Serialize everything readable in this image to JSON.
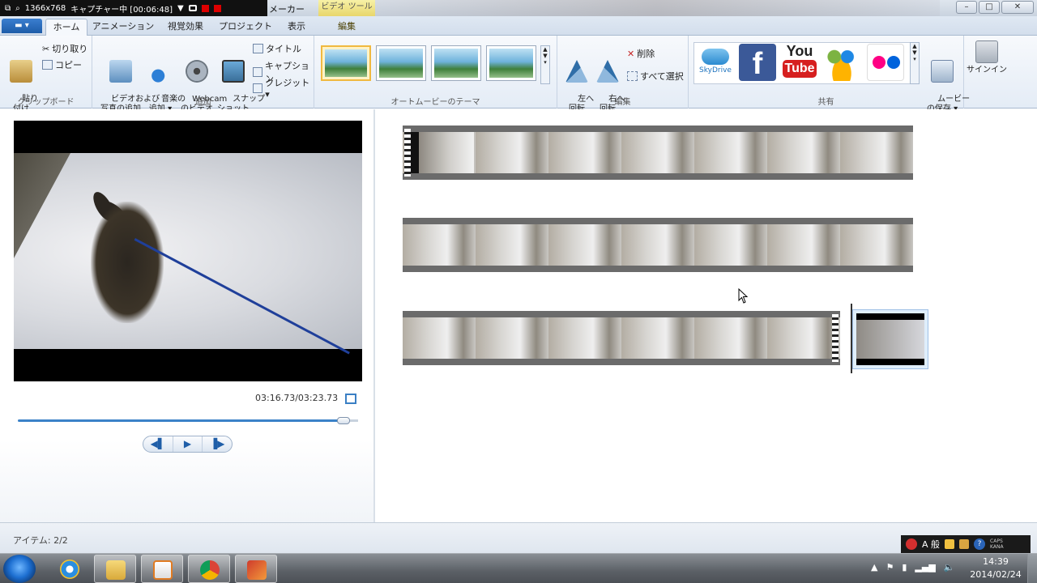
{
  "capture_toolbar": {
    "resolution": "1366x768",
    "status": "キャプチャー中 [00:06:48]"
  },
  "app": {
    "title_fragment": "メーカー",
    "context_tab_label": "ビデオ ツール"
  },
  "window_controls": {
    "minimize": "–",
    "maximize": "□",
    "close": "✕"
  },
  "tabs": [
    {
      "label": "ホーム",
      "active": true
    },
    {
      "label": "アニメーション"
    },
    {
      "label": "視覚効果"
    },
    {
      "label": "プロジェクト"
    },
    {
      "label": "表示"
    },
    {
      "label": "編集",
      "context": true
    }
  ],
  "ribbon": {
    "clipboard": {
      "paste": "貼り\n付け",
      "cut": "切り取り",
      "copy": "コピー",
      "label": "クリップボード"
    },
    "add": {
      "add_videos_photos": "ビデオおよび\n写真の追加",
      "add_music": "音楽の\n追加 ▾",
      "webcam_video": "Webcam\nのビデオ",
      "snapshot": "スナップ\nショット",
      "title": "タイトル",
      "caption": "キャプション",
      "credits": "クレジット ▾",
      "label": "追加"
    },
    "themes": {
      "label": "オートムービーのテーマ"
    },
    "editing": {
      "rotate_left": "左へ\n回転",
      "rotate_right": "右へ\n回転",
      "remove": "削除",
      "select_all": "すべて選択",
      "label": "編集"
    },
    "share": {
      "skydrive": "SkyDrive",
      "facebook": "f",
      "youtube_top": "You",
      "youtube_bottom": "Tube",
      "save_movie": "ムービー\nの保存 ▾",
      "label": "共有"
    },
    "signin": {
      "label": "サインイン"
    }
  },
  "preview": {
    "timecode": "03:16.73/03:23.73",
    "progress": 0.966,
    "buttons": {
      "prev": "◀▌",
      "play": "▶",
      "next": "▐▶"
    }
  },
  "statusbar": {
    "items": "アイテム: 2/2"
  },
  "ime": {
    "mode": "A 般",
    "help": "?",
    "caps": "CAPS",
    "kana": "KANA"
  },
  "taskbar": {
    "time": "14:39",
    "date": "2014/02/24"
  },
  "colors": {
    "accent": "#3b82c8",
    "ribbon_bg": "#e4ecf6",
    "taskbar": "#5b6066"
  }
}
